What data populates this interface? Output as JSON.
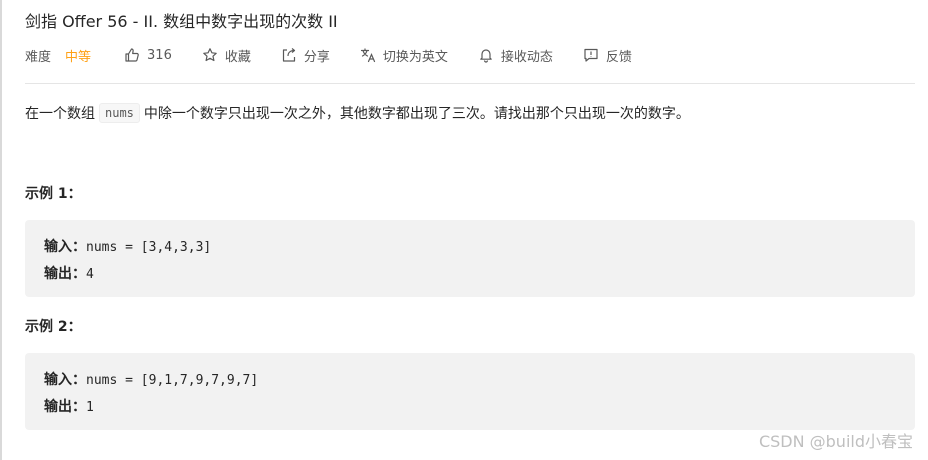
{
  "problem": {
    "title": "剑指 Offer 56 - II. 数组中数字出现的次数 II"
  },
  "meta": {
    "difficulty_label": "难度",
    "difficulty_value": "中等",
    "difficulty_color": "#ffa116",
    "likes": "316",
    "favorite_label": "收藏",
    "share_label": "分享",
    "translate_label": "切换为英文",
    "subscribe_label": "接收动态",
    "feedback_label": "反馈"
  },
  "description": {
    "before": "在一个数组",
    "code": "nums",
    "after": "中除一个数字只出现一次之外，其他数字都出现了三次。请找出那个只出现一次的数字。"
  },
  "examples": [
    {
      "title": "示例 1：",
      "input_label": "输入：",
      "input_value": "nums = [3,4,3,3]",
      "output_label": "输出：",
      "output_value": "4"
    },
    {
      "title": "示例 2：",
      "input_label": "输入：",
      "input_value": "nums = [9,1,7,9,7,9,7]",
      "output_label": "输出：",
      "output_value": "1"
    }
  ],
  "watermark": "CSDN @build小春宝"
}
